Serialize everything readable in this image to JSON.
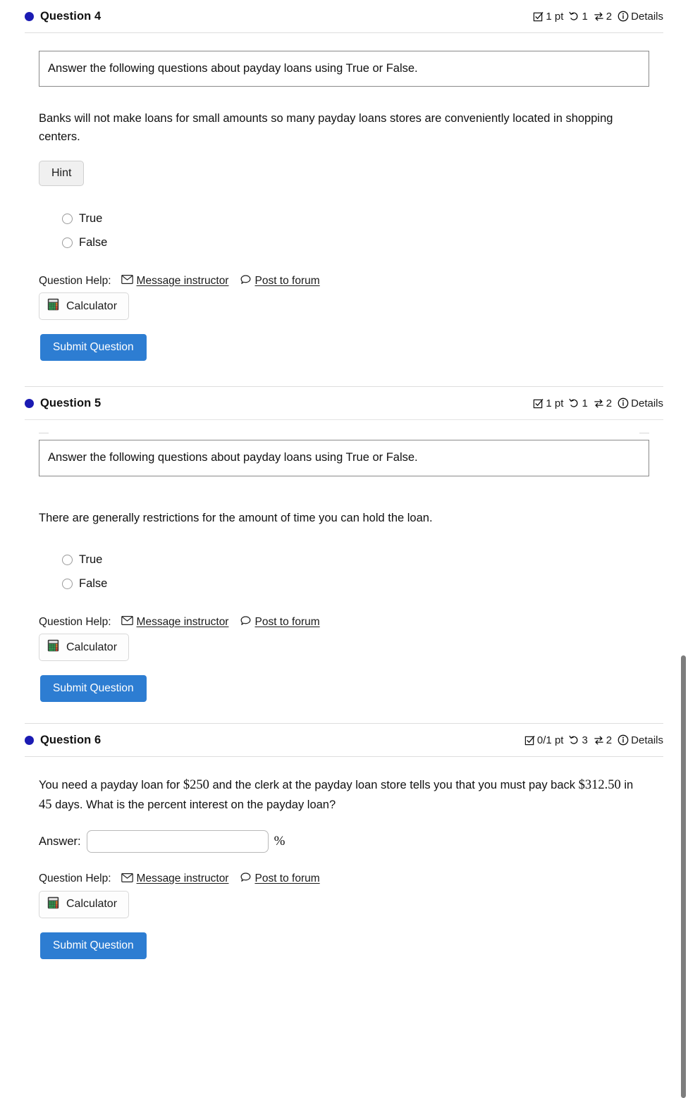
{
  "meta": {
    "accent_blue": "#2d7dd2",
    "bullet_navy": "#1b1bb3"
  },
  "common": {
    "instruction_box_text": "Answer the following questions about payday loans using True or False.",
    "hint_label": "Hint",
    "choice_true": "True",
    "choice_false": "False",
    "question_help_label": "Question Help:",
    "message_instructor_label": "Message instructor",
    "post_to_forum_label": "Post to forum",
    "calculator_label": "Calculator",
    "submit_label": "Submit Question",
    "details_label": "Details",
    "answer_label": "Answer:",
    "percent_symbol": "%",
    "answer_value": "",
    "answer_placeholder": ""
  },
  "questions": [
    {
      "title": "Question 4",
      "points": "1 pt",
      "attempts": "1",
      "versions": "2",
      "details": "Details",
      "has_instruction_box": true,
      "has_hint": true,
      "stem": "Banks will not make loans for small amounts so many payday loans stores are conveniently located in shopping centers.",
      "type": "true-false"
    },
    {
      "title": "Question 5",
      "points": "1 pt",
      "attempts": "1",
      "versions": "2",
      "details": "Details",
      "has_instruction_box": true,
      "has_hint": false,
      "stem": "There are generally restrictions for the amount of time you can hold the loan.",
      "type": "true-false"
    },
    {
      "title": "Question 6",
      "points": "0/1 pt",
      "attempts": "3",
      "versions": "2",
      "details": "Details",
      "has_instruction_box": false,
      "has_hint": false,
      "stem_parts": [
        {
          "t": "text",
          "v": "You need a payday loan for "
        },
        {
          "t": "math",
          "v": "$250"
        },
        {
          "t": "text",
          "v": " and the clerk at the payday loan store tells you that you must pay back "
        },
        {
          "t": "math",
          "v": "$312.50"
        },
        {
          "t": "text",
          "v": " in "
        },
        {
          "t": "math",
          "v": "45"
        },
        {
          "t": "text",
          "v": " days. What is the percent interest on the payday loan?"
        }
      ],
      "type": "numeric"
    }
  ],
  "icons": {
    "points": "check-square-icon",
    "attempts": "undo-arrow-icon",
    "versions": "swap-arrows-icon",
    "details": "info-circle-icon",
    "message": "envelope-icon",
    "forum": "speech-bubble-icon",
    "calculator": "calculator-icon"
  }
}
